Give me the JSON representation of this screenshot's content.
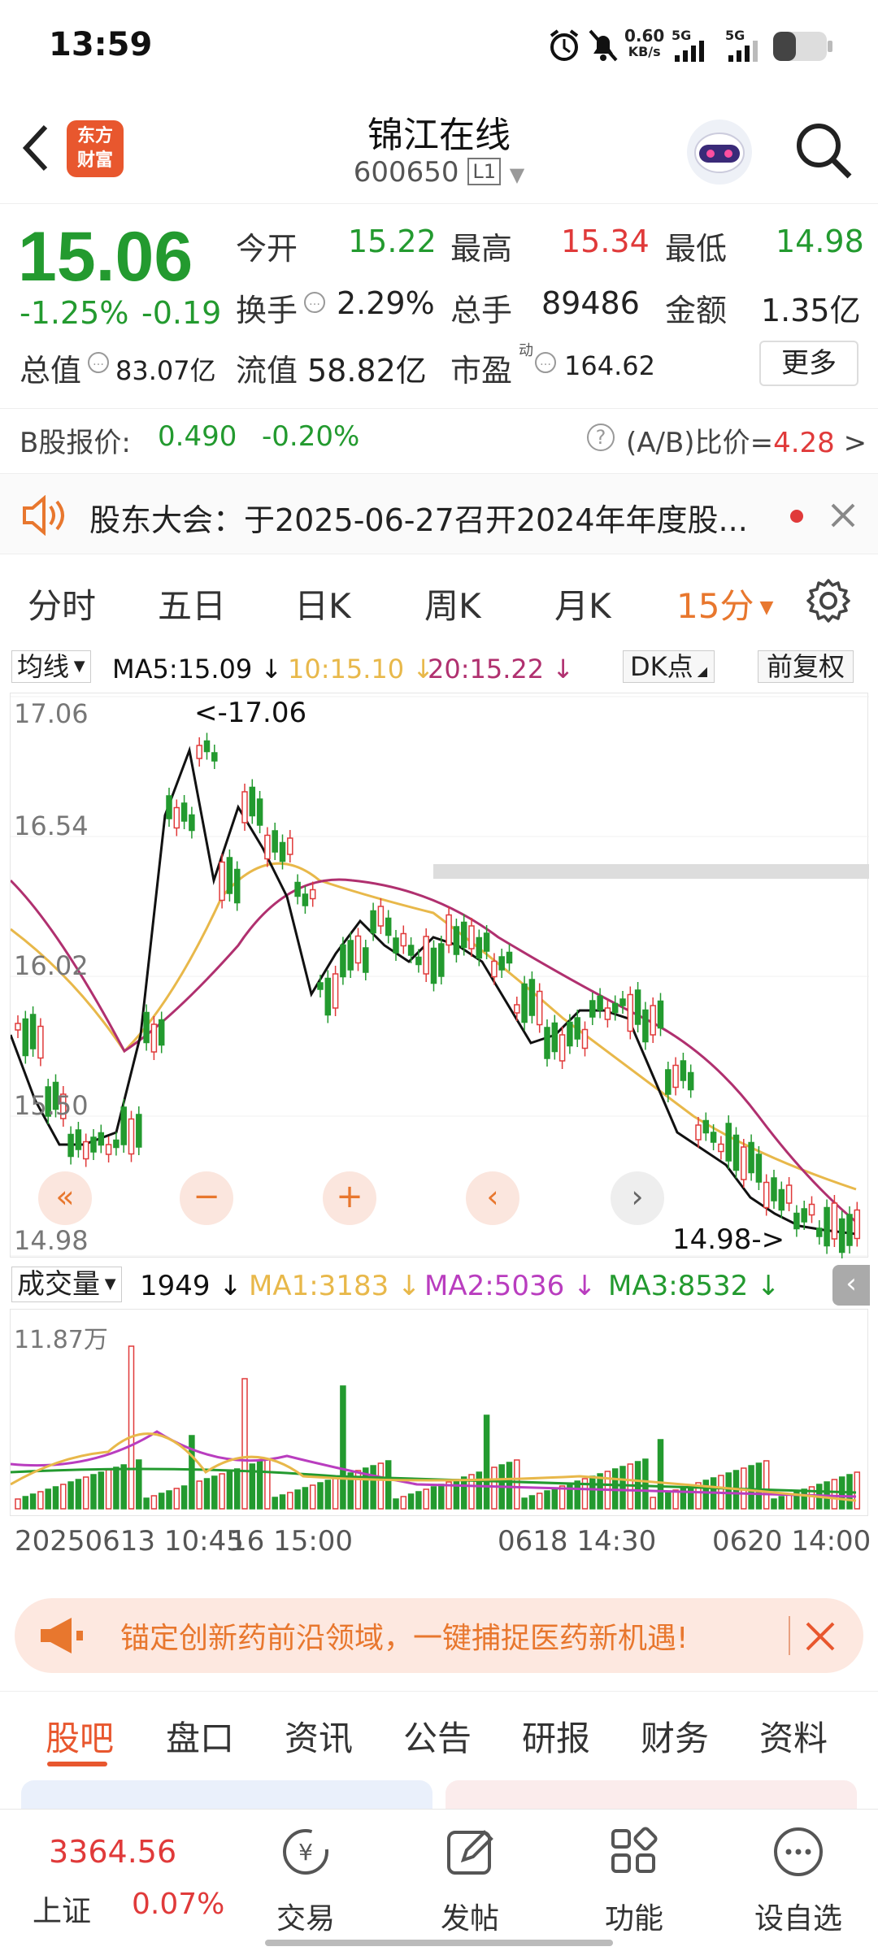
{
  "status": {
    "time": "13:59",
    "net_speed": "0.60",
    "net_unit": "KB/s",
    "sig1": "5G",
    "sig2": "5G"
  },
  "header": {
    "title": "锦江在线",
    "code": "600650",
    "level": "L1",
    "logo_line1": "东方",
    "logo_line2": "财富"
  },
  "quote": {
    "price": "15.06",
    "change_pct": "-1.25%",
    "change": "-0.19",
    "open_label": "今开",
    "open": "15.22",
    "high_label": "最高",
    "high": "15.34",
    "low_label": "最低",
    "low": "14.98",
    "turnover_label": "换手",
    "turnover": "2.29%",
    "vol_label": "总手",
    "vol": "89486",
    "amount_label": "金额",
    "amount": "1.35亿",
    "mktcap_label": "总值",
    "mktcap": "83.07亿",
    "float_label": "流值",
    "float": "58.82亿",
    "pe_label": "市盈",
    "pe_sup": "动",
    "pe": "164.62",
    "more": "更多"
  },
  "bshare": {
    "label": "B股报价:",
    "price": "0.490",
    "pct": "-0.20%",
    "ratio_label": "(A/B)比价=",
    "ratio": "4.28",
    "arrow": ">"
  },
  "notice": {
    "text": "股东大会：于2025-06-27召开2024年年度股..."
  },
  "period_tabs": [
    "分时",
    "五日",
    "日K",
    "周K",
    "月K",
    "15分"
  ],
  "ma_bar": {
    "type": "均线",
    "ma5": "MA5:15.09 ↓",
    "ma10": "10:15.10 ↓",
    "ma20": "20:15.22 ↓",
    "dk": "DK点",
    "adj": "前复权"
  },
  "chart_labels": {
    "y1": "17.06",
    "y2": "16.54",
    "y3": "16.02",
    "y4": "15.50",
    "y5": "14.98",
    "max_note": "<-17.06",
    "min_note": "14.98->"
  },
  "vol_bar": {
    "type": "成交量",
    "v": "1949 ↓",
    "ma1": "MA1:3183 ↓",
    "ma2": "MA2:5036 ↓",
    "ma3": "MA3:8532 ↓",
    "ymax": "11.87万"
  },
  "time_axis": {
    "t1": "20250613 10:45",
    "t2": "16 15:00",
    "t3": "0618 14:30",
    "t4": "0620 14:00"
  },
  "banner": {
    "text": "锚定创新药前沿领域，一键捕捉医药新机遇!"
  },
  "bottom_tabs": [
    "股吧",
    "盘口",
    "资讯",
    "公告",
    "研报",
    "财务",
    "资料"
  ],
  "dock": {
    "index_value": "3364.56",
    "index_name": "上证",
    "index_pct": "0.07%",
    "trade": "交易",
    "post": "发帖",
    "func": "功能",
    "fav": "设自选"
  },
  "colors": {
    "up": "#e03a3a",
    "down": "#239a2f",
    "ma5": "#111111",
    "ma10": "#e8b84a",
    "ma20": "#b0306f",
    "accent": "#e8772e"
  }
}
